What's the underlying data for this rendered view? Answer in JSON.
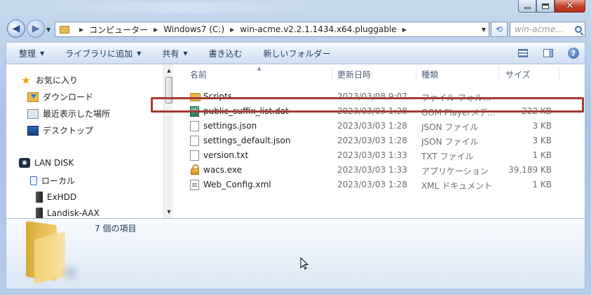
{
  "window": {
    "title_blurred": "",
    "controls": [
      "minimize",
      "maximize",
      "close"
    ]
  },
  "address_bar": {
    "breadcrumbs": [
      "コンピューター",
      "Windows7 (C:)",
      "win-acme.v2.2.1.1434.x64.pluggable"
    ],
    "search_placeholder": "win-acme..."
  },
  "toolbar": {
    "organize": "整理",
    "add_to_library": "ライブラリに追加",
    "share": "共有",
    "burn": "書き込む",
    "new_folder": "新しいフォルダー"
  },
  "sidebar": {
    "favorites": "お気に入り",
    "downloads": "ダウンロード",
    "recent_places": "最近表示した場所",
    "desktop": "デスクトップ",
    "lan_disk": "LAN DISK",
    "local": "ローカル",
    "exhdd": "ExHDD",
    "landisk_aax": "Landisk-AAX"
  },
  "columns": {
    "name": "名前",
    "date_modified": "更新日時",
    "type": "種類",
    "size": "サイズ"
  },
  "files": [
    {
      "name": "Scripts",
      "date": "2023/03/08 9:07",
      "type": "ファイル フォル...",
      "size": "",
      "icon": "folder-icon"
    },
    {
      "name": "public_suffix_list.dat",
      "date": "2023/03/03 1:28",
      "type": "GOM Playerメデ...",
      "size": "222 KB",
      "icon": "dat-file-icon"
    },
    {
      "name": "settings.json",
      "date": "2023/03/03 1:28",
      "type": "JSON ファイル",
      "size": "3 KB",
      "icon": "document-icon"
    },
    {
      "name": "settings_default.json",
      "date": "2023/03/03 1:28",
      "type": "JSON ファイル",
      "size": "3 KB",
      "icon": "document-icon"
    },
    {
      "name": "version.txt",
      "date": "2023/03/03 1:33",
      "type": "TXT ファイル",
      "size": "1 KB",
      "icon": "document-icon"
    },
    {
      "name": "wacs.exe",
      "date": "2023/03/03 1:33",
      "type": "アプリケーション",
      "size": "39,189 KB",
      "icon": "lock-icon"
    },
    {
      "name": "Web_Config.xml",
      "date": "2023/03/03 1:28",
      "type": "XML ドキュメント",
      "size": "1 KB",
      "icon": "xml-file-icon"
    }
  ],
  "highlighted_file": "wacs.exe",
  "details": {
    "item_count": "7 個の項目"
  },
  "colors": {
    "highlight_border": "#a33c2f",
    "toolbar_text": "#1e395b",
    "header_text": "#4c607a"
  }
}
